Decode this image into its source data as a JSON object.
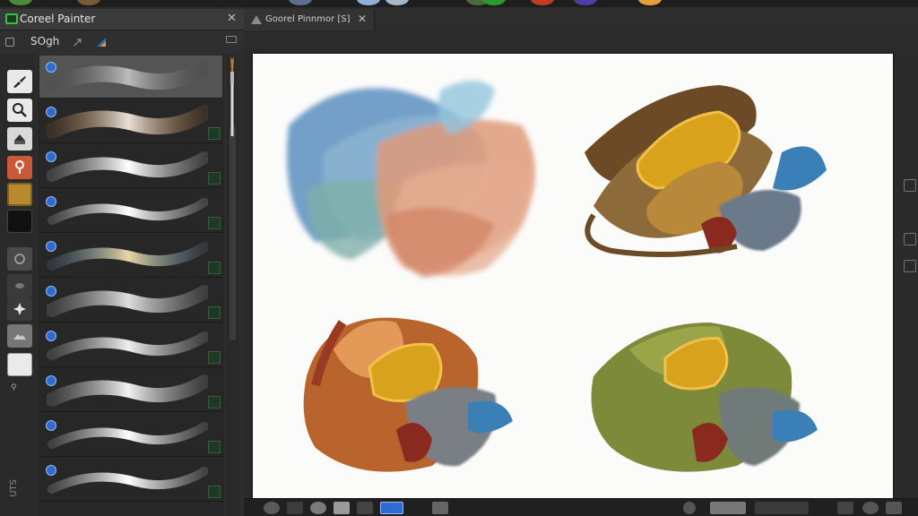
{
  "app": {
    "panel_title": "Coreel Painter",
    "document_title": "Goorel Pinnmor [S]",
    "close_glyph": "✕"
  },
  "brush_panel": {
    "category_label": "SOgh",
    "side_text": "UTS",
    "brushes": [
      {
        "name": "brush-variant-1",
        "selected": true
      },
      {
        "name": "brush-variant-2",
        "selected": false
      },
      {
        "name": "brush-variant-3",
        "selected": false
      },
      {
        "name": "brush-variant-4",
        "selected": false
      },
      {
        "name": "brush-variant-5",
        "selected": false
      },
      {
        "name": "brush-variant-6",
        "selected": false
      },
      {
        "name": "brush-variant-7",
        "selected": false
      },
      {
        "name": "brush-variant-8",
        "selected": false
      },
      {
        "name": "brush-variant-9",
        "selected": false
      },
      {
        "name": "brush-variant-10",
        "selected": false
      }
    ]
  },
  "tools": [
    {
      "icon": "brush-tool-icon"
    },
    {
      "icon": "magnifier-icon"
    },
    {
      "icon": "eraser-icon"
    },
    {
      "icon": "dropper-icon"
    },
    {
      "icon": "main-color-swatch"
    },
    {
      "icon": "secondary-color-swatch"
    },
    {
      "icon": "layer-tool-icon"
    },
    {
      "icon": "blend-tool-icon"
    },
    {
      "icon": "transform-tool-icon"
    },
    {
      "icon": "paper-tool-icon"
    },
    {
      "icon": "white-swatch"
    }
  ],
  "colors": {
    "main_color": "#b68a2d",
    "secondary_color": "#111111",
    "accent_green": "#39c049",
    "badge_blue": "#2d6bd1"
  }
}
